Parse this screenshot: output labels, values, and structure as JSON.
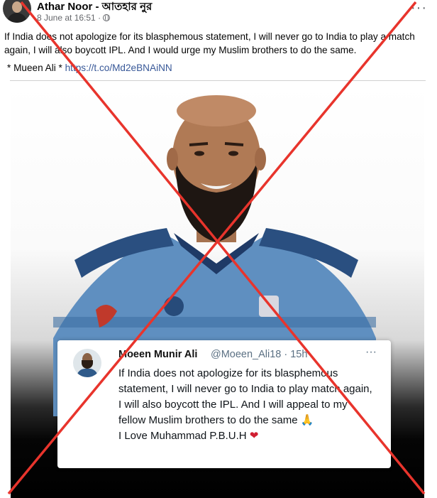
{
  "post": {
    "author": "Athar Noor - আতহার নুর",
    "timestamp": "8 June at 16:51 ·",
    "privacy_icon": "globe-icon",
    "more_label": "···",
    "text": "If India does not apologize for its blasphemous statement, I will never go to India to play a match again, I will also boycott IPL.  And I would urge my Muslim brothers to do the same.",
    "attribution": "* Mueen Ali *",
    "link": "https://t.co/Md2eBNAiNN"
  },
  "tweet": {
    "name": "Moeen Munir Ali",
    "handle": "@Moeen_Ali18 · 15h",
    "more_label": "···",
    "text": "If India does not apologize for its blasphemous statement, I will never go to India to play match again, I will also boycott the IPL.  And I will appeal to my fellow Muslim brothers to do the same 🙏",
    "closing": "I Love Muhammad P.B.U.H",
    "heart": "❤"
  },
  "overlay": {
    "type": "red-x-cross",
    "color": "#e8342c"
  }
}
